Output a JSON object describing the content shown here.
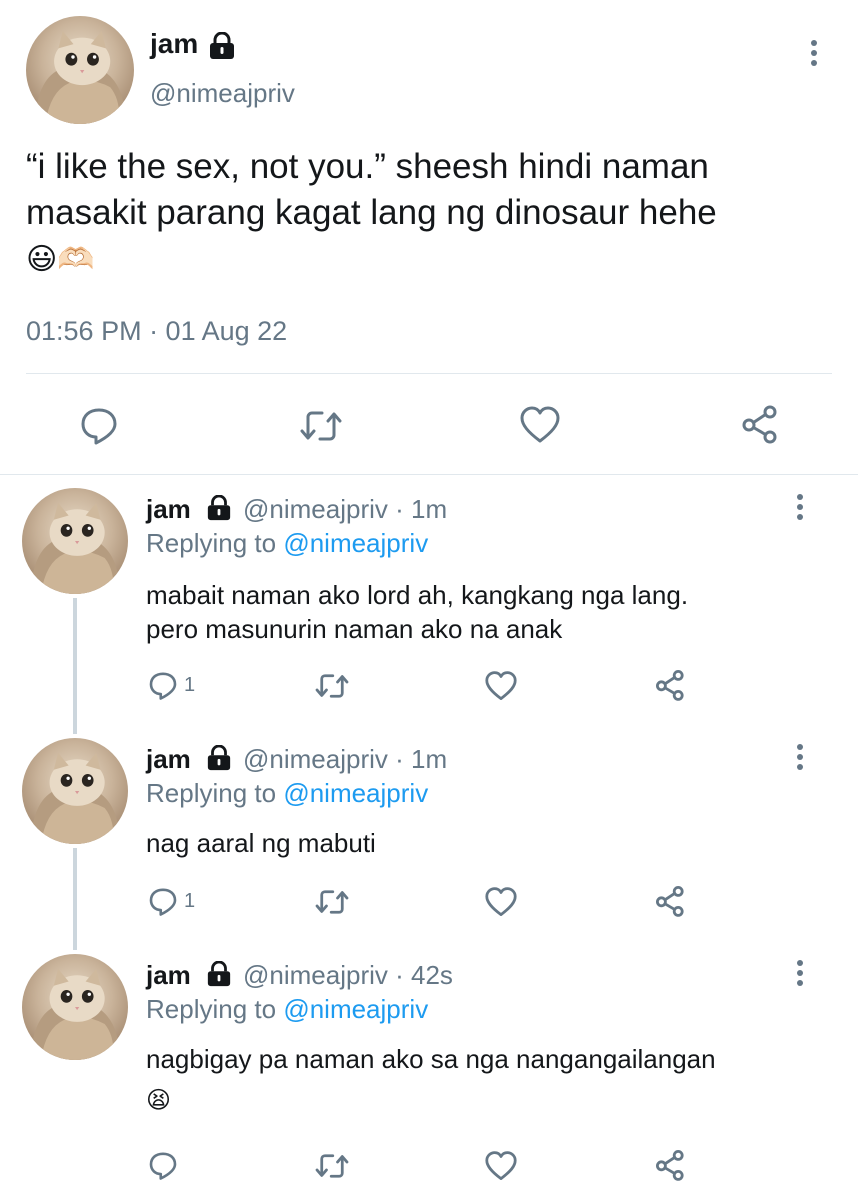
{
  "colors": {
    "accent": "#1d9bf0",
    "muted": "#657786",
    "text": "#14171a",
    "thread_line": "#ccd6dd"
  },
  "main_tweet": {
    "display_name": "jam",
    "handle": "@nimeajpriv",
    "text": "“i like the sex, not you.” sheesh hindi naman masakit parang kagat lang ng dinosaur hehe",
    "emojis": "😃🫶🏻",
    "timestamp": "01:56 PM · 01 Aug 22",
    "actions": [
      "reply-icon",
      "retweet-icon",
      "like-icon",
      "share-icon"
    ]
  },
  "replies": [
    {
      "display_name": "jam",
      "handle_time": "@nimeajpriv · 1m",
      "replying_prefix": "Replying to ",
      "replying_handle": "@nimeajpriv",
      "text_line1": "mabait naman ako lord ah, kangkang nga lang.",
      "text_line2": "pero masunurin naman ako na anak",
      "reply_count": "1"
    },
    {
      "display_name": "jam",
      "handle_time": "@nimeajpriv · 1m",
      "replying_prefix": "Replying to ",
      "replying_handle": "@nimeajpriv",
      "text_line1": "nag aaral ng mabuti",
      "reply_count": "1"
    },
    {
      "display_name": "jam",
      "handle_time": "@nimeajpriv · 42s",
      "replying_prefix": "Replying to ",
      "replying_handle": "@nimeajpriv",
      "text_line1": "nagbigay pa naman ako sa nga nangangailangan",
      "emoji": "😫",
      "reply_count": ""
    }
  ]
}
